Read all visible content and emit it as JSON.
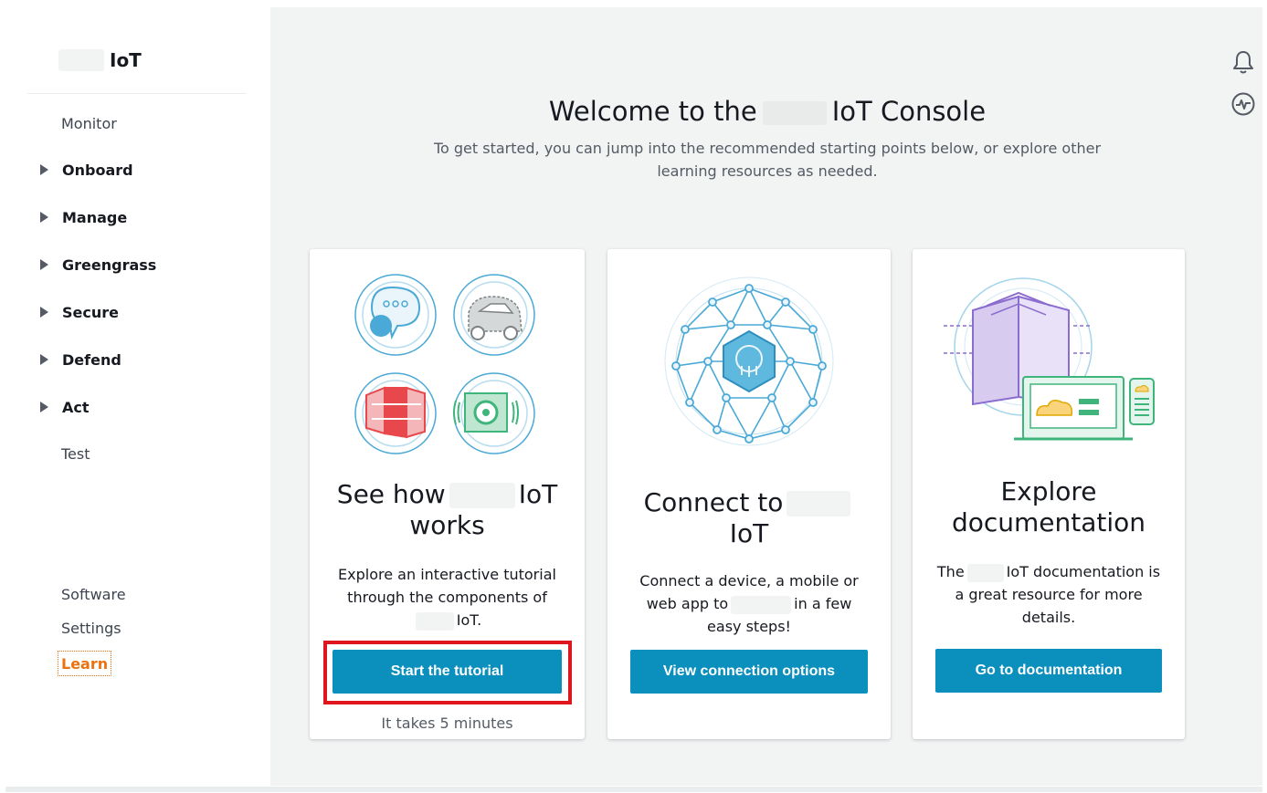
{
  "sidebar": {
    "brand": "IoT",
    "nav": [
      {
        "label": "Monitor"
      },
      {
        "label": "Onboard"
      },
      {
        "label": "Manage"
      },
      {
        "label": "Greengrass"
      },
      {
        "label": "Secure"
      },
      {
        "label": "Defend"
      },
      {
        "label": "Act"
      },
      {
        "label": "Test"
      }
    ],
    "footer": {
      "software": "Software",
      "settings": "Settings",
      "learn": "Learn"
    }
  },
  "header": {
    "title_prefix": "Welcome to the",
    "title_suffix": "IoT Console",
    "subtitle": "To get started, you can jump into the recommended starting points below, or explore other learning resources as needed."
  },
  "cards": [
    {
      "title_prefix": "See how",
      "title_suffix": "IoT",
      "title_line2": "works",
      "desc_line1": "Explore an interactive tutorial",
      "desc_line2": "through the components of",
      "desc_line3": "IoT.",
      "button": "Start the tutorial",
      "note": "It takes 5 minutes"
    },
    {
      "title_prefix": "Connect to",
      "title_line2": "IoT",
      "desc_line1": "Connect a device, a mobile or",
      "desc_line2_prefix": "web app to",
      "desc_line2_suffix": "in a few",
      "desc_line3": "easy steps!",
      "button": "View connection options"
    },
    {
      "title_line1": "Explore",
      "title_line2": "documentation",
      "desc_line1_prefix": "The",
      "desc_line1_suffix": "IoT documentation is",
      "desc_line2": "a great resource for more",
      "desc_line3": "details.",
      "button": "Go to documentation"
    }
  ],
  "colors": {
    "accent_orange": "#ec7211",
    "button_blue": "#0b8fbd",
    "highlight_red": "#e0161e",
    "illustration_blue": "#4aa9d6",
    "illustration_red": "#e8474c",
    "illustration_purple": "#8b6ccf",
    "illustration_green": "#3fb57c"
  },
  "icons": {
    "notifications": "bell-icon",
    "health": "pulse-icon"
  }
}
